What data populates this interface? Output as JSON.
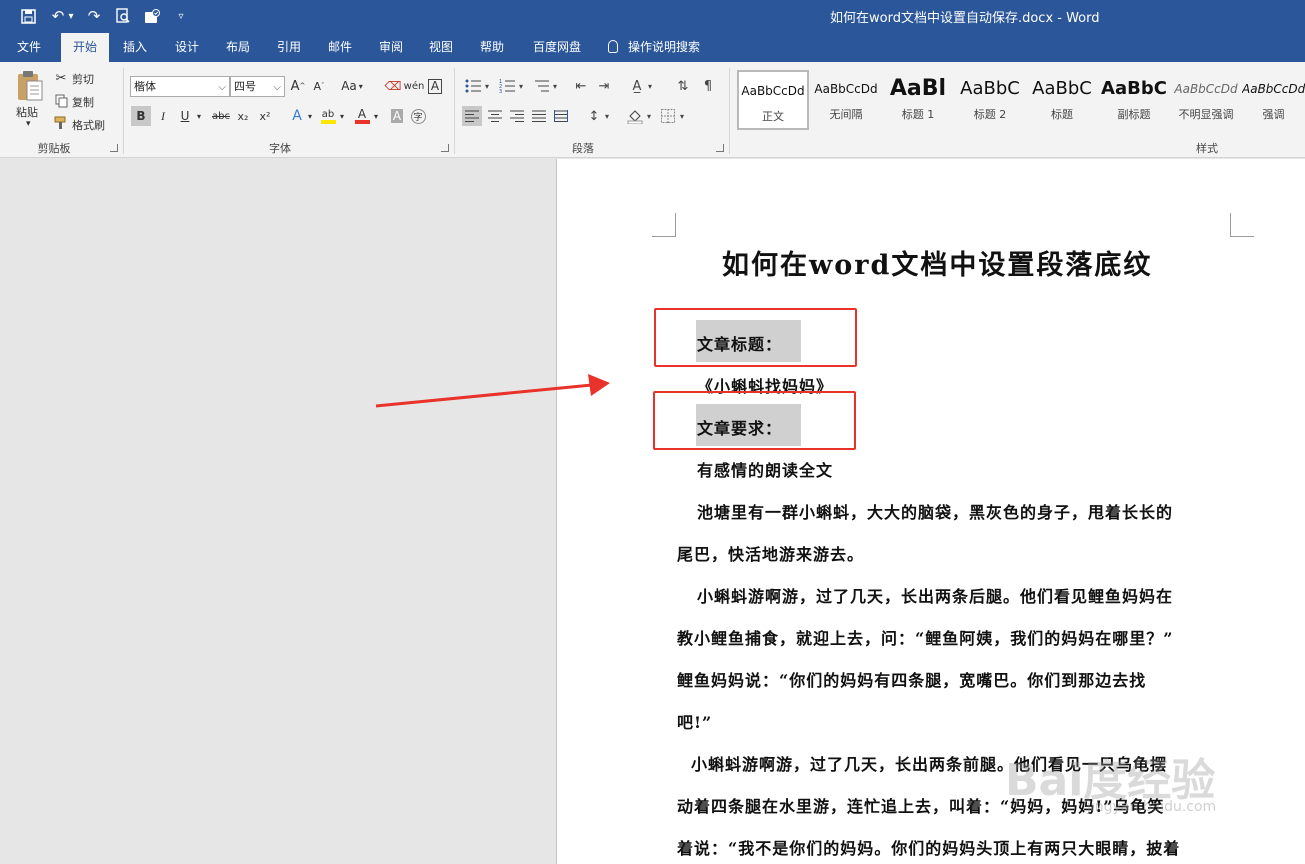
{
  "window": {
    "title": "如何在word文档中设置自动保存.docx  -  Word",
    "quick_access": [
      "save-icon",
      "undo-icon",
      "redo-icon",
      "print-preview-icon",
      "touch-mode-icon",
      "customize-icon"
    ]
  },
  "tabs": [
    {
      "label": "文件",
      "active": false
    },
    {
      "label": "开始",
      "active": true
    },
    {
      "label": "插入",
      "active": false
    },
    {
      "label": "设计",
      "active": false
    },
    {
      "label": "布局",
      "active": false
    },
    {
      "label": "引用",
      "active": false
    },
    {
      "label": "邮件",
      "active": false
    },
    {
      "label": "审阅",
      "active": false
    },
    {
      "label": "视图",
      "active": false
    },
    {
      "label": "帮助",
      "active": false
    },
    {
      "label": "百度网盘",
      "active": false
    }
  ],
  "tell_me": "操作说明搜索",
  "clipboard": {
    "paste": "粘贴",
    "cut": "剪切",
    "copy": "复制",
    "format_painter": "格式刷",
    "group_label": "剪贴板"
  },
  "font": {
    "name": "楷体",
    "size": "四号",
    "group_label": "字体",
    "bold": "B",
    "italic": "I",
    "underline": "U",
    "strike": "abc",
    "subscript": "x₂",
    "superscript": "x²",
    "grow": "A",
    "shrink": "A",
    "change_case": "Aa",
    "phonetic": "wén",
    "char_border": "A",
    "text_effect": "A",
    "highlight": "ab",
    "font_color": "A",
    "char_shading": "A",
    "enclose": "字"
  },
  "paragraph": {
    "group_label": "段落"
  },
  "styles": {
    "group_label": "样式",
    "items": [
      {
        "preview": "AaBbCcDd",
        "name": "正文",
        "selected": true
      },
      {
        "preview": "AaBbCcDd",
        "name": "无间隔",
        "selected": false
      },
      {
        "preview": "AaBl",
        "name": "标题 1",
        "selected": false
      },
      {
        "preview": "AaBbC",
        "name": "标题 2",
        "selected": false
      },
      {
        "preview": "AaBbC",
        "name": "标题",
        "selected": false
      },
      {
        "preview": "AaBbC",
        "name": "副标题",
        "selected": false
      },
      {
        "preview": "AaBbCcDd",
        "name": "不明显强调",
        "selected": false
      },
      {
        "preview": "AaBbCcDd",
        "name": "强调",
        "selected": false
      }
    ]
  },
  "document": {
    "heading": "如何在word文档中设置段落底纹",
    "lines": [
      "文章标题：",
      "《小蝌蚪找妈妈》",
      "文章要求：",
      "有感情的朗读全文",
      "池塘里有一群小蝌蚪，大大的脑袋，黑灰色的身子，甩着长长的",
      "尾巴，快活地游来游去。",
      "小蝌蚪游啊游，过了几天，长出两条后腿。他们看见鲤鱼妈妈在",
      "教小鲤鱼捕食，就迎上去，问：“鲤鱼阿姨，我们的妈妈在哪里？”",
      "鲤鱼妈妈说：“你们的妈妈有四条腿，宽嘴巴。你们到那边去找",
      "吧!”",
      "小蝌蚪游啊游，过了几天，长出两条前腿。他们看见一只乌龟摆",
      "动着四条腿在水里游，连忙追上去，叫着：“妈妈，妈妈!”乌龟笑",
      "着说：“我不是你们的妈妈。你们的妈妈头顶上有两只大眼睛，披着"
    ]
  },
  "annotation": {
    "color": "#e8322a"
  },
  "watermark": {
    "main": "Bai度经验",
    "sub": "jingyan.baidu.com"
  },
  "colors": {
    "brand": "#2b579a",
    "highlight": "#ffe600",
    "font_color": "#e8322a"
  }
}
